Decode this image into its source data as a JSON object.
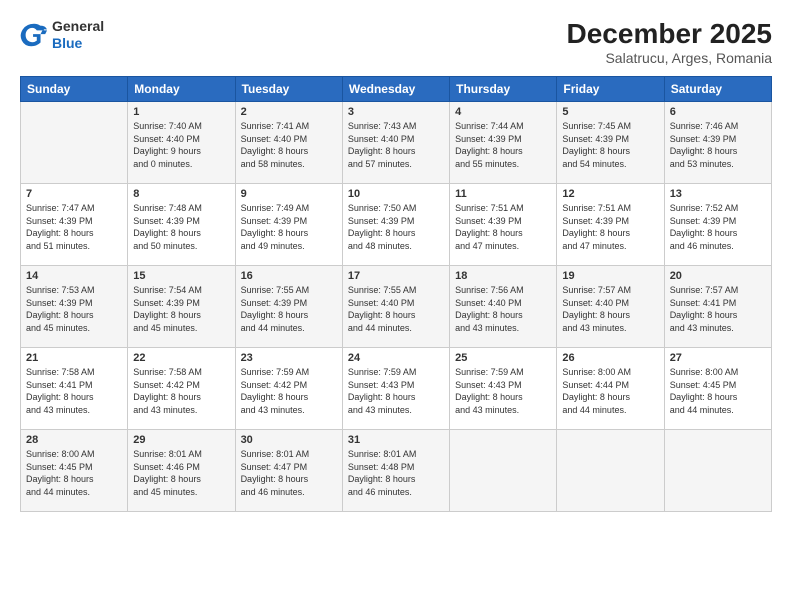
{
  "header": {
    "logo_line1": "General",
    "logo_line2": "Blue",
    "month_year": "December 2025",
    "location": "Salatrucu, Arges, Romania"
  },
  "days_of_week": [
    "Sunday",
    "Monday",
    "Tuesday",
    "Wednesday",
    "Thursday",
    "Friday",
    "Saturday"
  ],
  "weeks": [
    [
      {
        "day": "",
        "info": ""
      },
      {
        "day": "1",
        "info": "Sunrise: 7:40 AM\nSunset: 4:40 PM\nDaylight: 9 hours\nand 0 minutes."
      },
      {
        "day": "2",
        "info": "Sunrise: 7:41 AM\nSunset: 4:40 PM\nDaylight: 8 hours\nand 58 minutes."
      },
      {
        "day": "3",
        "info": "Sunrise: 7:43 AM\nSunset: 4:40 PM\nDaylight: 8 hours\nand 57 minutes."
      },
      {
        "day": "4",
        "info": "Sunrise: 7:44 AM\nSunset: 4:39 PM\nDaylight: 8 hours\nand 55 minutes."
      },
      {
        "day": "5",
        "info": "Sunrise: 7:45 AM\nSunset: 4:39 PM\nDaylight: 8 hours\nand 54 minutes."
      },
      {
        "day": "6",
        "info": "Sunrise: 7:46 AM\nSunset: 4:39 PM\nDaylight: 8 hours\nand 53 minutes."
      }
    ],
    [
      {
        "day": "7",
        "info": "Sunrise: 7:47 AM\nSunset: 4:39 PM\nDaylight: 8 hours\nand 51 minutes."
      },
      {
        "day": "8",
        "info": "Sunrise: 7:48 AM\nSunset: 4:39 PM\nDaylight: 8 hours\nand 50 minutes."
      },
      {
        "day": "9",
        "info": "Sunrise: 7:49 AM\nSunset: 4:39 PM\nDaylight: 8 hours\nand 49 minutes."
      },
      {
        "day": "10",
        "info": "Sunrise: 7:50 AM\nSunset: 4:39 PM\nDaylight: 8 hours\nand 48 minutes."
      },
      {
        "day": "11",
        "info": "Sunrise: 7:51 AM\nSunset: 4:39 PM\nDaylight: 8 hours\nand 47 minutes."
      },
      {
        "day": "12",
        "info": "Sunrise: 7:51 AM\nSunset: 4:39 PM\nDaylight: 8 hours\nand 47 minutes."
      },
      {
        "day": "13",
        "info": "Sunrise: 7:52 AM\nSunset: 4:39 PM\nDaylight: 8 hours\nand 46 minutes."
      }
    ],
    [
      {
        "day": "14",
        "info": "Sunrise: 7:53 AM\nSunset: 4:39 PM\nDaylight: 8 hours\nand 45 minutes."
      },
      {
        "day": "15",
        "info": "Sunrise: 7:54 AM\nSunset: 4:39 PM\nDaylight: 8 hours\nand 45 minutes."
      },
      {
        "day": "16",
        "info": "Sunrise: 7:55 AM\nSunset: 4:39 PM\nDaylight: 8 hours\nand 44 minutes."
      },
      {
        "day": "17",
        "info": "Sunrise: 7:55 AM\nSunset: 4:40 PM\nDaylight: 8 hours\nand 44 minutes."
      },
      {
        "day": "18",
        "info": "Sunrise: 7:56 AM\nSunset: 4:40 PM\nDaylight: 8 hours\nand 43 minutes."
      },
      {
        "day": "19",
        "info": "Sunrise: 7:57 AM\nSunset: 4:40 PM\nDaylight: 8 hours\nand 43 minutes."
      },
      {
        "day": "20",
        "info": "Sunrise: 7:57 AM\nSunset: 4:41 PM\nDaylight: 8 hours\nand 43 minutes."
      }
    ],
    [
      {
        "day": "21",
        "info": "Sunrise: 7:58 AM\nSunset: 4:41 PM\nDaylight: 8 hours\nand 43 minutes."
      },
      {
        "day": "22",
        "info": "Sunrise: 7:58 AM\nSunset: 4:42 PM\nDaylight: 8 hours\nand 43 minutes."
      },
      {
        "day": "23",
        "info": "Sunrise: 7:59 AM\nSunset: 4:42 PM\nDaylight: 8 hours\nand 43 minutes."
      },
      {
        "day": "24",
        "info": "Sunrise: 7:59 AM\nSunset: 4:43 PM\nDaylight: 8 hours\nand 43 minutes."
      },
      {
        "day": "25",
        "info": "Sunrise: 7:59 AM\nSunset: 4:43 PM\nDaylight: 8 hours\nand 43 minutes."
      },
      {
        "day": "26",
        "info": "Sunrise: 8:00 AM\nSunset: 4:44 PM\nDaylight: 8 hours\nand 44 minutes."
      },
      {
        "day": "27",
        "info": "Sunrise: 8:00 AM\nSunset: 4:45 PM\nDaylight: 8 hours\nand 44 minutes."
      }
    ],
    [
      {
        "day": "28",
        "info": "Sunrise: 8:00 AM\nSunset: 4:45 PM\nDaylight: 8 hours\nand 44 minutes."
      },
      {
        "day": "29",
        "info": "Sunrise: 8:01 AM\nSunset: 4:46 PM\nDaylight: 8 hours\nand 45 minutes."
      },
      {
        "day": "30",
        "info": "Sunrise: 8:01 AM\nSunset: 4:47 PM\nDaylight: 8 hours\nand 46 minutes."
      },
      {
        "day": "31",
        "info": "Sunrise: 8:01 AM\nSunset: 4:48 PM\nDaylight: 8 hours\nand 46 minutes."
      },
      {
        "day": "",
        "info": ""
      },
      {
        "day": "",
        "info": ""
      },
      {
        "day": "",
        "info": ""
      }
    ]
  ]
}
